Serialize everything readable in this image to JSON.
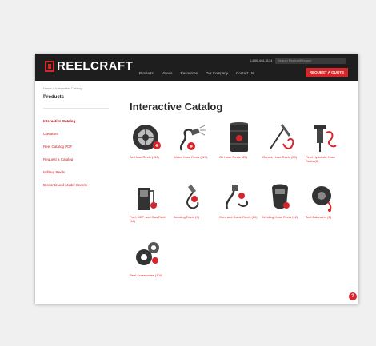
{
  "header": {
    "brand": "REELCRAFT",
    "phone": "1-800-444-3134",
    "search_placeholder": "Search ReelcraftSearch",
    "nav": [
      "Products",
      "Videos",
      "Resources",
      "Our Company",
      "Contact Us"
    ],
    "request_button": "REQUEST A QUOTE"
  },
  "breadcrumb": "Home > Interactive Catalog",
  "sidebar": {
    "title": "Products",
    "items": [
      "Interactive Catalog",
      "Literature",
      "Reel Catalog PDF",
      "Request a Catalog",
      "Military Reels",
      "Discontinued Model Search"
    ]
  },
  "main": {
    "title": "Interactive Catalog",
    "tiles": [
      {
        "label": "Air Hose Reels (110)",
        "icon": "tire-reel-icon"
      },
      {
        "label": "Water Hose Reels (113)",
        "icon": "water-hose-icon"
      },
      {
        "label": "Oil Hose Reels (83)",
        "icon": "oil-drum-icon"
      },
      {
        "label": "Grease Hose Reels (59)",
        "icon": "grease-gun-icon"
      },
      {
        "label": "Fluid Hydraulic Hose Reels (8)",
        "icon": "jackhammer-icon"
      },
      {
        "label": "Fuel, DEF, and Gas Reels (18)",
        "icon": "fuel-pump-icon"
      },
      {
        "label": "Bonding Reels (3)",
        "icon": "bonding-clamp-icon"
      },
      {
        "label": "Cord and Cable Reels (19)",
        "icon": "cord-plug-icon"
      },
      {
        "label": "Welding Hose Reels (12)",
        "icon": "welding-mask-icon"
      },
      {
        "label": "Tool Balancers (8)",
        "icon": "tool-balancer-icon"
      },
      {
        "label": "Reel Accessories (104)",
        "icon": "gears-icon"
      }
    ]
  },
  "chat_label": "?"
}
